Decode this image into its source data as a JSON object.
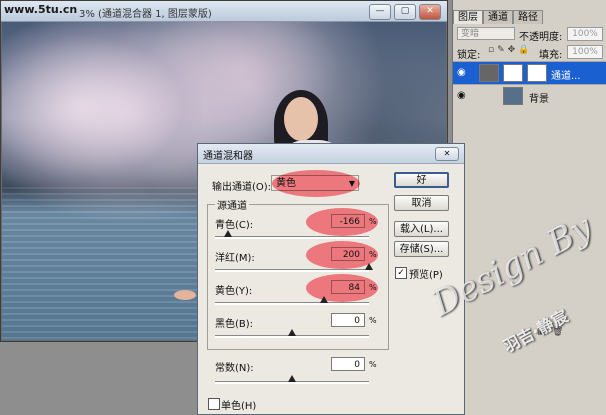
{
  "site_watermark": "www.5tu.cn",
  "document": {
    "title_suffix": "3% (通道混合器 1, 图层蒙版)",
    "buttons": {
      "minimize": "—",
      "maximize": "▢",
      "close": "✕"
    }
  },
  "layers_panel": {
    "tabs": [
      "图层",
      "通道",
      "路径"
    ],
    "blend_mode": "变暗",
    "opacity_label": "不透明度:",
    "opacity_value": "100%",
    "lock_label": "锁定:",
    "fill_label": "填充:",
    "fill_value": "100%",
    "layers": [
      {
        "name": "通道...",
        "selected": true
      },
      {
        "name": "背景",
        "selected": false
      }
    ]
  },
  "dialog": {
    "title": "通道混和器",
    "output_label": "输出通道(O):",
    "output_value": "黄色",
    "source_group": "源通道",
    "channels": [
      {
        "label": "青色(C):",
        "value": "-166",
        "unit": "%",
        "fraction": 0.085
      },
      {
        "label": "洋红(M):",
        "value": "200",
        "unit": "%",
        "fraction": 1.0
      },
      {
        "label": "黄色(Y):",
        "value": "84",
        "unit": "%",
        "fraction": 0.71
      },
      {
        "label": "黑色(B):",
        "value": "0",
        "unit": "%",
        "fraction": 0.5
      }
    ],
    "constant": {
      "label": "常数(N):",
      "value": "0",
      "unit": "%",
      "fraction": 0.5
    },
    "mono_label": "单色(H)",
    "buttons": {
      "ok": "好",
      "cancel": "取消",
      "load": "载入(L)...",
      "save": "存储(S)..."
    },
    "preview_label": "预览(P)",
    "preview_checked": "✓"
  },
  "overlay_text": {
    "design": "Design By",
    "author": "羽吉·静宸"
  },
  "colors": {
    "highlight": "#ec4c56",
    "selection": "#1a60d1"
  }
}
